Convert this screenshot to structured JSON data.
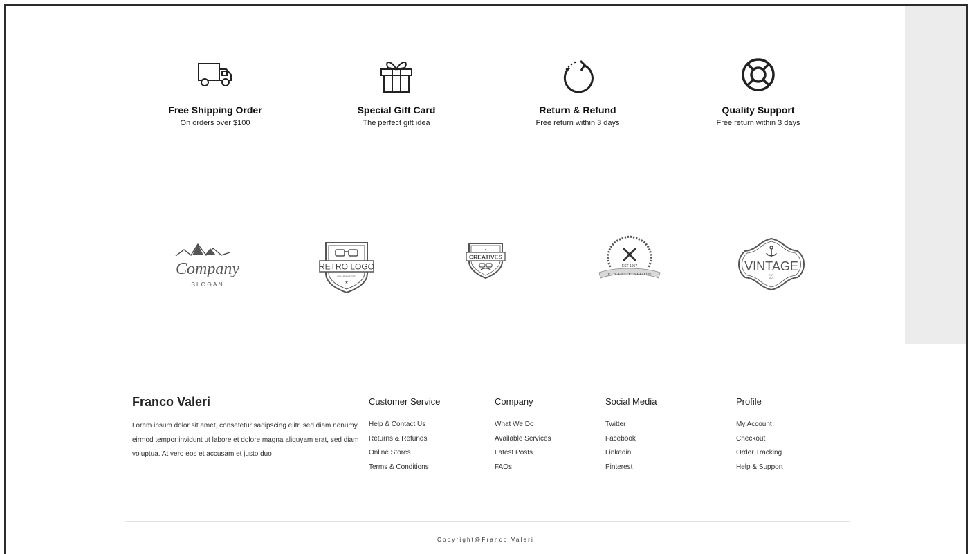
{
  "features": [
    {
      "icon": "truck-icon",
      "title": "Free Shipping Order",
      "subtitle": "On orders over $100"
    },
    {
      "icon": "gift-icon",
      "title": "Special Gift Card",
      "subtitle": "The perfect gift idea"
    },
    {
      "icon": "refund-icon",
      "title": "Return & Refund",
      "subtitle": "Free return within 3 days"
    },
    {
      "icon": "lifebuoy-icon",
      "title": "Quality Support",
      "subtitle": "Free return within 3 days"
    }
  ],
  "brands": {
    "company": {
      "name": "Company",
      "slogan": "SLOGAN"
    },
    "retro": {
      "name": "RETRO LOGO",
      "tag": "GUARANTEED"
    },
    "creatives": {
      "name": "CREATIVES"
    },
    "vintage_spoon": {
      "est": "EST-1957",
      "name": "VINTAGE SPOON"
    },
    "vintage": {
      "name": "VINTAGE",
      "est": "EST.",
      "year": "1927"
    }
  },
  "footer": {
    "brand_name": "Franco Valeri",
    "description": "Lorem ipsum dolor sit amet, consetetur sadipscing elitr, sed diam nonumy eirmod tempor invidunt ut labore et dolore magna aliquyam erat, sed diam voluptua. At vero eos et accusam et justo duo",
    "columns": [
      {
        "heading": "Customer Service",
        "links": [
          "Help & Contact Us",
          "Returns & Refunds",
          "Online Stores",
          "Terms & Conditions"
        ]
      },
      {
        "heading": "Company",
        "links": [
          "What We Do",
          "Available Services",
          "Latest Posts",
          "FAQs"
        ]
      },
      {
        "heading": "Social Media",
        "links": [
          "Twitter",
          "Facebook",
          "Linkedin",
          "Pinterest"
        ]
      },
      {
        "heading": "Profile",
        "links": [
          "My Account",
          "Checkout",
          "Order Tracking",
          "Help & Support"
        ]
      }
    ],
    "copyright": "Copyright@Franco Valeri"
  }
}
